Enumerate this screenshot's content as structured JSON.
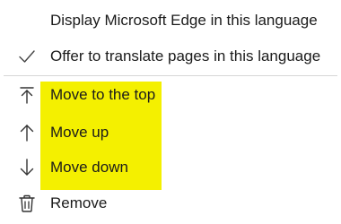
{
  "menu": {
    "items": [
      {
        "label": "Display Microsoft Edge in this language",
        "icon": "none"
      },
      {
        "label": "Offer to translate pages in this language",
        "icon": "checkmark-icon",
        "checked": true
      },
      {
        "label": "Move to the top",
        "icon": "move-to-top-icon",
        "highlighted": true
      },
      {
        "label": "Move up",
        "icon": "arrow-up-icon",
        "highlighted": true
      },
      {
        "label": "Move down",
        "icon": "arrow-down-icon",
        "highlighted": true
      },
      {
        "label": "Remove",
        "icon": "trash-icon"
      }
    ],
    "highlight_color": "#f4f000",
    "text_color": "#1b1b1b"
  }
}
